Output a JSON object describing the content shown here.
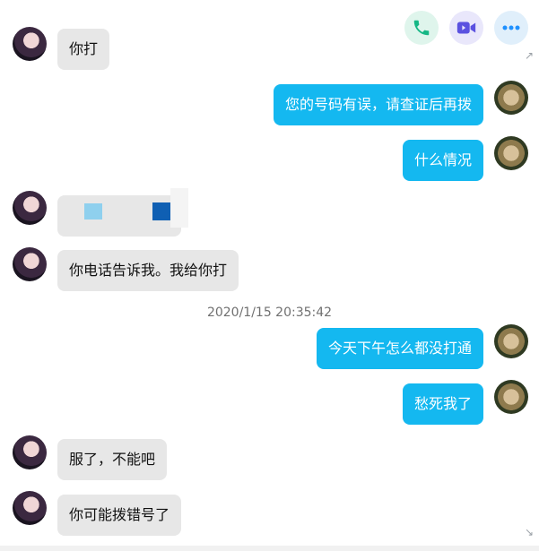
{
  "toolbar": {
    "call_icon": "phone-icon",
    "video_icon": "video-icon",
    "more_icon": "more-icon",
    "call_color": "#16b785",
    "video_color": "#5b51e0",
    "more_color": "#1e90ff"
  },
  "messages": [
    {
      "side": "left",
      "text": "你打"
    },
    {
      "side": "right",
      "text": "您的号码有误，请查证后再拨"
    },
    {
      "side": "right",
      "text": "什么情况"
    },
    {
      "side": "left",
      "text": ""
    },
    {
      "side": "left",
      "text": "你电话告诉我。我给你打"
    },
    {
      "side": "timestamp",
      "text": "2020/1/15 20:35:42"
    },
    {
      "side": "right",
      "text": "今天下午怎么都没打通"
    },
    {
      "side": "right",
      "text": "愁死我了"
    },
    {
      "side": "left",
      "text": "服了，不能吧"
    },
    {
      "side": "left",
      "text": "你可能拨错号了"
    }
  ],
  "colors": {
    "bubble_right": "#14b8f0",
    "bubble_left": "#e7e7e7",
    "timestamp": "#707070"
  }
}
